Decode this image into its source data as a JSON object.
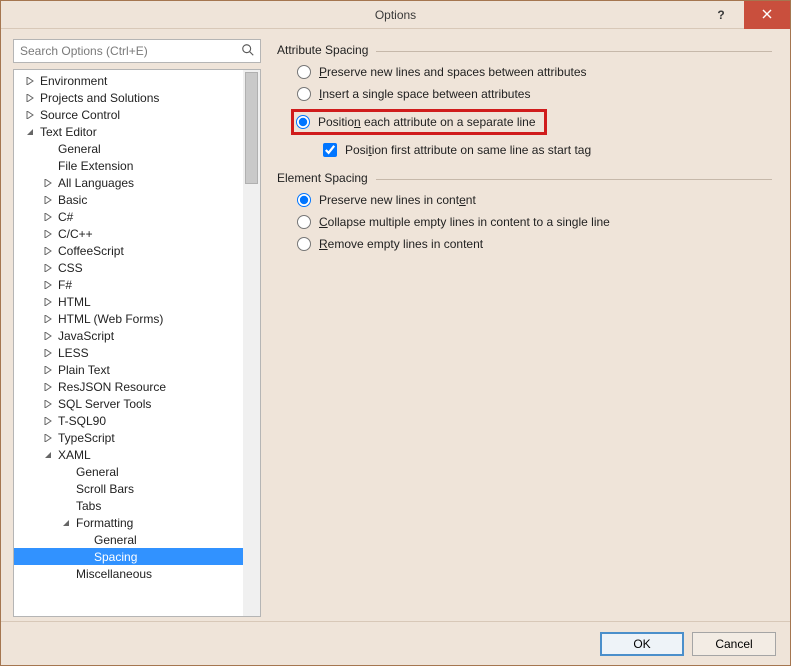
{
  "window": {
    "title": "Options"
  },
  "search": {
    "placeholder": "Search Options (Ctrl+E)"
  },
  "tree": [
    {
      "label": "Environment",
      "depth": 0,
      "glyph": "collapsed"
    },
    {
      "label": "Projects and Solutions",
      "depth": 0,
      "glyph": "collapsed"
    },
    {
      "label": "Source Control",
      "depth": 0,
      "glyph": "collapsed"
    },
    {
      "label": "Text Editor",
      "depth": 0,
      "glyph": "expanded"
    },
    {
      "label": "General",
      "depth": 1,
      "glyph": "none"
    },
    {
      "label": "File Extension",
      "depth": 1,
      "glyph": "none"
    },
    {
      "label": "All Languages",
      "depth": 1,
      "glyph": "collapsed"
    },
    {
      "label": "Basic",
      "depth": 1,
      "glyph": "collapsed"
    },
    {
      "label": "C#",
      "depth": 1,
      "glyph": "collapsed"
    },
    {
      "label": "C/C++",
      "depth": 1,
      "glyph": "collapsed"
    },
    {
      "label": "CoffeeScript",
      "depth": 1,
      "glyph": "collapsed"
    },
    {
      "label": "CSS",
      "depth": 1,
      "glyph": "collapsed"
    },
    {
      "label": "F#",
      "depth": 1,
      "glyph": "collapsed"
    },
    {
      "label": "HTML",
      "depth": 1,
      "glyph": "collapsed"
    },
    {
      "label": "HTML (Web Forms)",
      "depth": 1,
      "glyph": "collapsed"
    },
    {
      "label": "JavaScript",
      "depth": 1,
      "glyph": "collapsed"
    },
    {
      "label": "LESS",
      "depth": 1,
      "glyph": "collapsed"
    },
    {
      "label": "Plain Text",
      "depth": 1,
      "glyph": "collapsed"
    },
    {
      "label": "ResJSON Resource",
      "depth": 1,
      "glyph": "collapsed"
    },
    {
      "label": "SQL Server Tools",
      "depth": 1,
      "glyph": "collapsed"
    },
    {
      "label": "T-SQL90",
      "depth": 1,
      "glyph": "collapsed"
    },
    {
      "label": "TypeScript",
      "depth": 1,
      "glyph": "collapsed"
    },
    {
      "label": "XAML",
      "depth": 1,
      "glyph": "expanded"
    },
    {
      "label": "General",
      "depth": 2,
      "glyph": "none"
    },
    {
      "label": "Scroll Bars",
      "depth": 2,
      "glyph": "none"
    },
    {
      "label": "Tabs",
      "depth": 2,
      "glyph": "none"
    },
    {
      "label": "Formatting",
      "depth": 2,
      "glyph": "expanded"
    },
    {
      "label": "General",
      "depth": 3,
      "glyph": "none"
    },
    {
      "label": "Spacing",
      "depth": 3,
      "glyph": "none",
      "selected": true
    },
    {
      "label": "Miscellaneous",
      "depth": 2,
      "glyph": "none"
    }
  ],
  "attribute_spacing": {
    "title": "Attribute Spacing",
    "opt1": {
      "mn": "P",
      "rest": "reserve new lines and spaces between attributes"
    },
    "opt2": {
      "mn": "I",
      "rest": "nsert a single space between attributes"
    },
    "opt3": {
      "before": "Positio",
      "mn": "n",
      "after": " each attribute on a separate line"
    },
    "sub": {
      "before": "Posi",
      "mn": "t",
      "after": "ion first attribute on same line as start tag"
    },
    "selected": "opt3",
    "sub_checked": true
  },
  "element_spacing": {
    "title": "Element Spacing",
    "opt1": {
      "before": "Preserve new lines in cont",
      "mn": "e",
      "after": "nt"
    },
    "opt2": {
      "mn": "C",
      "rest": "ollapse multiple empty lines in content to a single line"
    },
    "opt3": {
      "mn": "R",
      "rest": "emove empty lines in content"
    },
    "selected": "opt1"
  },
  "buttons": {
    "ok": "OK",
    "cancel": "Cancel"
  }
}
